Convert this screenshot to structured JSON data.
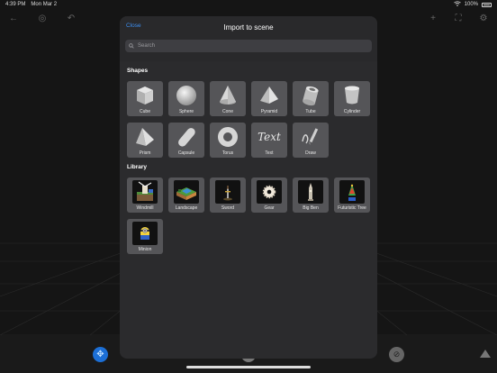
{
  "status": {
    "time": "4:39 PM",
    "date": "Mon Mar 2",
    "battery": "100%"
  },
  "modal": {
    "close_label": "Close",
    "title": "Import to scene",
    "search_placeholder": "Search"
  },
  "sections": {
    "shapes_title": "Shapes",
    "library_title": "Library"
  },
  "shapes": [
    {
      "label": "Cube",
      "icon": "cube-icon"
    },
    {
      "label": "Sphere",
      "icon": "sphere-icon"
    },
    {
      "label": "Cone",
      "icon": "cone-icon"
    },
    {
      "label": "Pyramid",
      "icon": "pyramid-icon"
    },
    {
      "label": "Tube",
      "icon": "tube-icon"
    },
    {
      "label": "Cylinder",
      "icon": "cylinder-icon"
    },
    {
      "label": "Prism",
      "icon": "prism-icon"
    },
    {
      "label": "Capsule",
      "icon": "capsule-icon"
    },
    {
      "label": "Torus",
      "icon": "torus-icon"
    },
    {
      "label": "Text",
      "icon": "text-icon",
      "art_text": "Text"
    },
    {
      "label": "Draw",
      "icon": "draw-icon"
    }
  ],
  "library": [
    {
      "label": "Windmill",
      "icon": "windmill-icon"
    },
    {
      "label": "Landscape",
      "icon": "landscape-icon"
    },
    {
      "label": "Sword",
      "icon": "sword-icon"
    },
    {
      "label": "Gear",
      "icon": "gear-icon"
    },
    {
      "label": "Big Ben",
      "icon": "big-ben-icon"
    },
    {
      "label": "Futuristic Tree",
      "icon": "futuristic-tree-icon"
    },
    {
      "label": "Minion",
      "icon": "minion-icon"
    }
  ],
  "colors": {
    "accent": "#3d8ef0",
    "tile": "#555558",
    "modal": "#2b2b2d"
  }
}
